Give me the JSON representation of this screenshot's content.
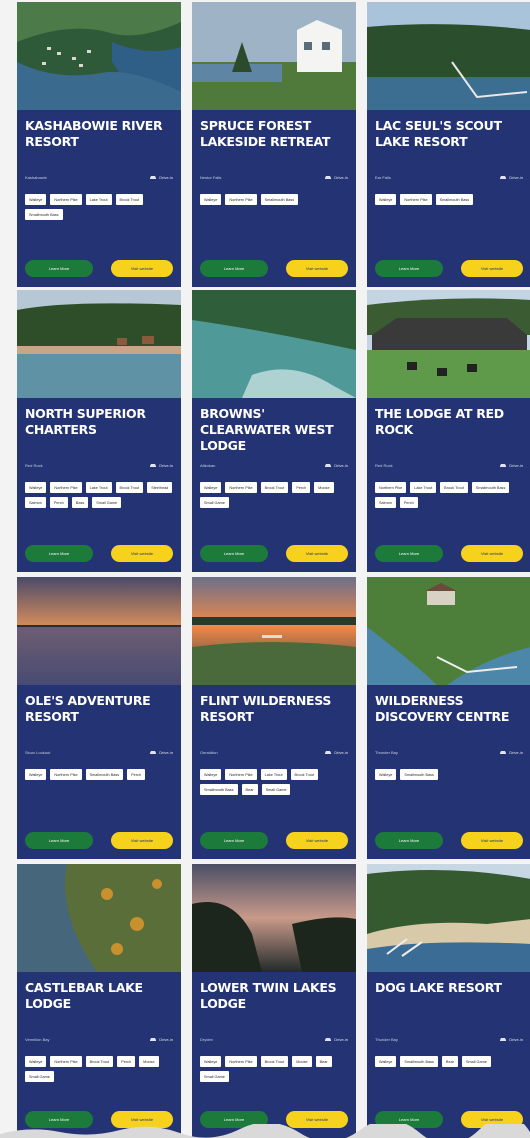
{
  "cards": [
    {
      "title": "Kashabowie River Resort",
      "location": "Kashabowie",
      "distance": "Drive-in",
      "tags": [
        "Walleye",
        "Northern Pike",
        "Lake Trout",
        "Brook Trout",
        "Smallmouth Bass"
      ],
      "learn_label": "Learn More",
      "visit_label": "Visit website",
      "photo": "aerial-river-resort"
    },
    {
      "title": "Spruce Forest Lakeside Retreat",
      "location": "Nestor Falls",
      "distance": "Drive-in",
      "tags": [
        "Walleye",
        "Northern Pike",
        "Smallmouth Bass"
      ],
      "learn_label": "Learn More",
      "visit_label": "Visit website",
      "photo": "white-house-lakeside"
    },
    {
      "title": "Lac Seul's Scout Lake Resort",
      "location": "Ear Falls",
      "distance": "Drive-in",
      "tags": [
        "Walleye",
        "Northern Pike",
        "Smallmouth Bass"
      ],
      "learn_label": "Learn More",
      "visit_label": "Visit website",
      "photo": "dock-forest-lake"
    },
    {
      "title": "North Superior Charters",
      "location": "Red Rock",
      "distance": "Drive-in",
      "tags": [
        "Walleye",
        "Northern Pike",
        "Lake Trout",
        "Brook Trout",
        "Steelhead",
        "Salmon",
        "Perch",
        "Bass",
        "Small Game"
      ],
      "learn_label": "Learn More",
      "visit_label": "Visit website",
      "photo": "shoreline-cabins"
    },
    {
      "title": "Browns' Clearwater West Lodge",
      "location": "Atikokan",
      "distance": "Drive-in",
      "tags": [
        "Walleye",
        "Northern Pike",
        "Brook Trout",
        "Perch",
        "Moose",
        "Small Game"
      ],
      "learn_label": "Learn More",
      "visit_label": "Visit website",
      "photo": "clear-lake-aerial"
    },
    {
      "title": "The Lodge at Red Rock",
      "location": "Red Rock",
      "distance": "Drive-in",
      "tags": [
        "Northern Pike",
        "Lake Trout",
        "Brook Trout",
        "Smallmouth Bass",
        "Salmon",
        "Perch"
      ],
      "learn_label": "Learn More",
      "visit_label": "Visit website",
      "photo": "lodge-firepit"
    },
    {
      "title": "Ole's Adventure Resort",
      "location": "Sioux Lookout",
      "distance": "Drive-in",
      "tags": [
        "Walleye",
        "Northern Pike",
        "Smallmouth Bass",
        "Perch"
      ],
      "learn_label": "Learn More",
      "visit_label": "Visit website",
      "photo": "sunset-lake"
    },
    {
      "title": "Flint Wilderness Resort",
      "location": "Geraldton",
      "distance": "Drive-in",
      "tags": [
        "Walleye",
        "Northern Pike",
        "Lake Trout",
        "Brook Trout",
        "Smallmouth Bass",
        "Bear",
        "Small Game"
      ],
      "learn_label": "Learn More",
      "visit_label": "Visit website",
      "photo": "sunset-dock"
    },
    {
      "title": "Wilderness Discovery Centre",
      "location": "Thunder Bay",
      "distance": "Drive-in",
      "tags": [
        "Walleye",
        "Smallmouth Bass"
      ],
      "learn_label": "Learn More",
      "visit_label": "Visit website",
      "photo": "aerial-cottage-docks"
    },
    {
      "title": "Castlebar Lake Lodge",
      "location": "Vermilion Bay",
      "distance": "Drive-in",
      "tags": [
        "Walleye",
        "Northern Pike",
        "Brook Trout",
        "Perch",
        "Moose",
        "Small Game"
      ],
      "learn_label": "Learn More",
      "visit_label": "Visit website",
      "photo": "autumn-aerial"
    },
    {
      "title": "Lower Twin Lakes Lodge",
      "location": "Dryden",
      "distance": "Drive-in",
      "tags": [
        "Walleye",
        "Northern Pike",
        "Brook Trout",
        "Moose",
        "Bear",
        "Small Game"
      ],
      "learn_label": "Learn More",
      "visit_label": "Visit website",
      "photo": "dusk-lake-silhouette"
    },
    {
      "title": "Dog Lake Resort",
      "location": "Thunder Bay",
      "distance": "Drive-in",
      "tags": [
        "Walleye",
        "Smallmouth Bass",
        "Bear",
        "Small Game"
      ],
      "learn_label": "Learn More",
      "visit_label": "Visit website",
      "photo": "beach-docks-aerial"
    }
  ],
  "colors": {
    "card_bg": "#233373",
    "learn_button": "#1c7a3a",
    "visit_button": "#f7d21c",
    "tag_bg": "#ffffff"
  }
}
